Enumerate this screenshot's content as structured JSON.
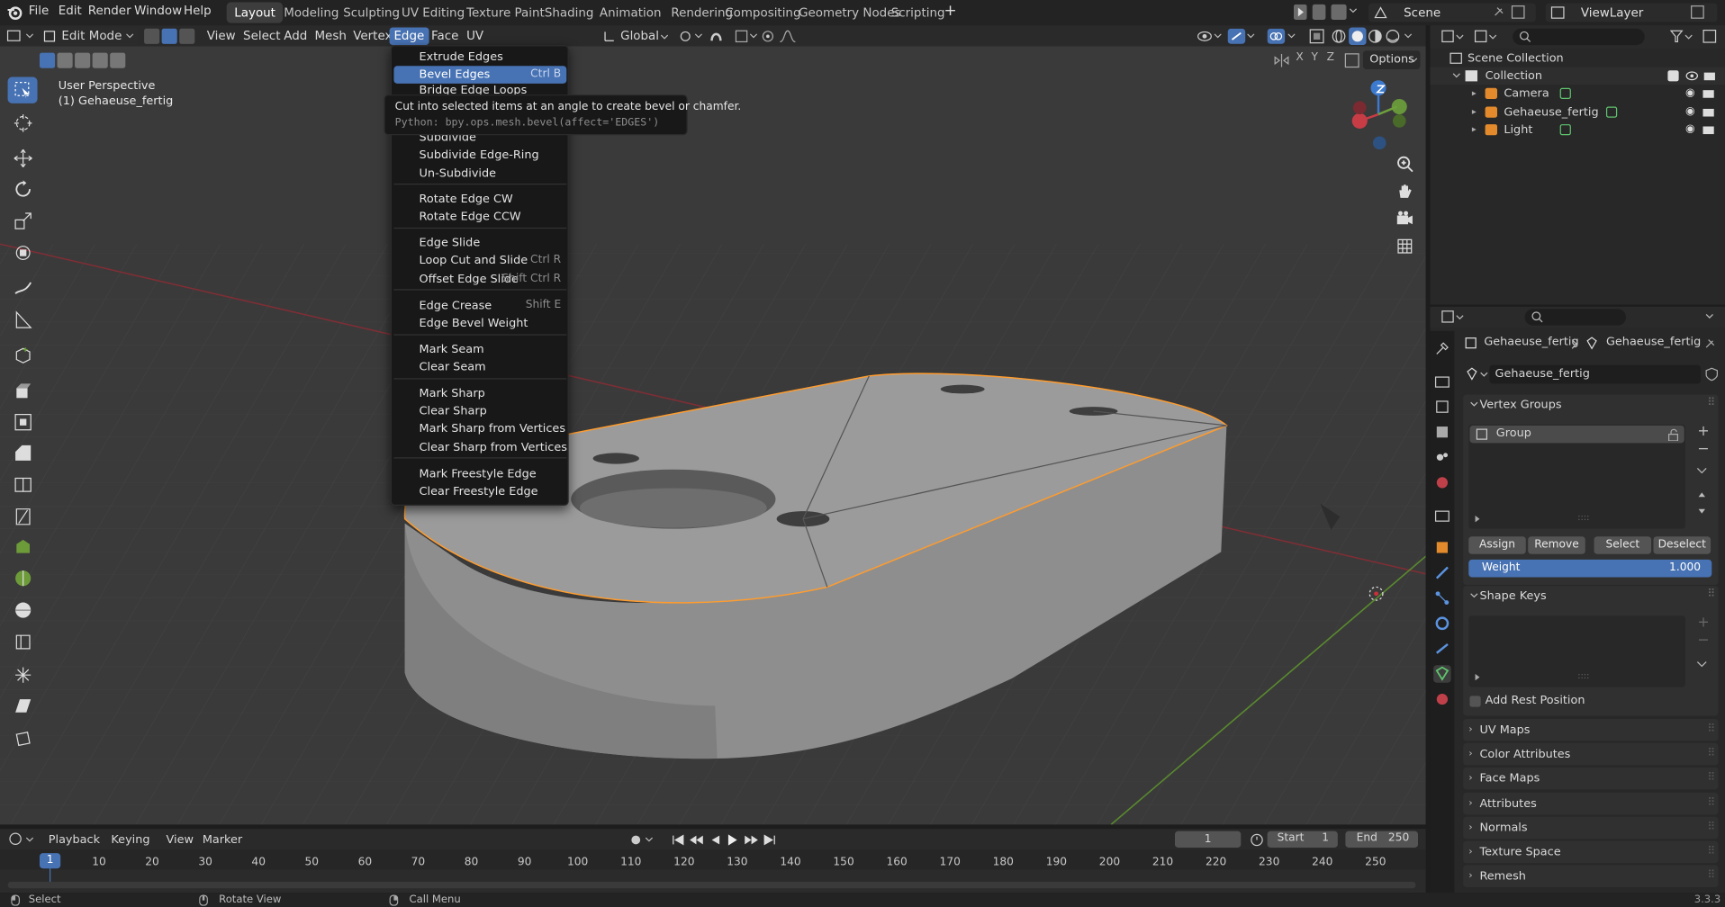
{
  "app_menu": [
    "File",
    "Edit",
    "Render",
    "Window",
    "Help"
  ],
  "workspaces": [
    "Layout",
    "Modeling",
    "Sculpting",
    "UV Editing",
    "Texture Paint",
    "Shading",
    "Animation",
    "Rendering",
    "Compositing",
    "Geometry Nodes",
    "Scripting"
  ],
  "add_workspace": "+",
  "scene_name": "Scene",
  "view_layer": "ViewLayer",
  "viewport_header": {
    "mode": "Edit Mode",
    "menus": [
      "View",
      "Select",
      "Add",
      "Mesh",
      "Vertex",
      "Edge",
      "Face",
      "UV"
    ],
    "transform_orientation": "Global",
    "options": "Options",
    "axes": [
      "X",
      "Y",
      "Z"
    ]
  },
  "viewport": {
    "perspective": "User Perspective",
    "object_label": "(1) Gehaeuse_fertig"
  },
  "edge_menu": {
    "items": [
      {
        "label": "Extrude Edges",
        "shortcut": ""
      },
      {
        "label": "Bevel Edges",
        "shortcut": "Ctrl B"
      },
      {
        "label": "Bridge Edge Loops",
        "shortcut": ""
      },
      {
        "label": "Subdivide",
        "shortcut": ""
      },
      {
        "label": "Subdivide Edge-Ring",
        "shortcut": ""
      },
      {
        "label": "Un-Subdivide",
        "shortcut": ""
      },
      {
        "label": "Rotate Edge CW",
        "shortcut": ""
      },
      {
        "label": "Rotate Edge CCW",
        "shortcut": ""
      },
      {
        "label": "Edge Slide",
        "shortcut": ""
      },
      {
        "label": "Loop Cut and Slide",
        "shortcut": "Ctrl R"
      },
      {
        "label": "Offset Edge Slide",
        "shortcut": "Shift Ctrl R"
      },
      {
        "label": "Edge Crease",
        "shortcut": "Shift E"
      },
      {
        "label": "Edge Bevel Weight",
        "shortcut": ""
      },
      {
        "label": "Mark Seam",
        "shortcut": ""
      },
      {
        "label": "Clear Seam",
        "shortcut": ""
      },
      {
        "label": "Mark Sharp",
        "shortcut": ""
      },
      {
        "label": "Clear Sharp",
        "shortcut": ""
      },
      {
        "label": "Mark Sharp from Vertices",
        "shortcut": ""
      },
      {
        "label": "Clear Sharp from Vertices",
        "shortcut": ""
      },
      {
        "label": "Mark Freestyle Edge",
        "shortcut": ""
      },
      {
        "label": "Clear Freestyle Edge",
        "shortcut": ""
      }
    ]
  },
  "tooltip": {
    "description": "Cut into selected items at an angle to create bevel or chamfer.",
    "python": "Python: bpy.ops.mesh.bevel(affect='EDGES')"
  },
  "outliner": {
    "root": "Scene Collection",
    "collection": "Collection",
    "objects": [
      "Camera",
      "Gehaeuse_fertig",
      "Light"
    ]
  },
  "properties": {
    "breadcrumb": [
      "Gehaeuse_fertig",
      "Gehaeuse_fertig"
    ],
    "mesh_name": "Gehaeuse_fertig",
    "vertex_groups": {
      "title": "Vertex Groups",
      "items": [
        "Group"
      ],
      "buttons": [
        "Assign",
        "Remove",
        "Select",
        "Deselect"
      ],
      "weight_label": "Weight",
      "weight_value": "1.000"
    },
    "shape_keys": {
      "title": "Shape Keys",
      "add_rest_position": "Add Rest Position"
    },
    "collapsed_panels": [
      "UV Maps",
      "Color Attributes",
      "Face Maps",
      "Attributes",
      "Normals",
      "Texture Space",
      "Remesh"
    ]
  },
  "timeline": {
    "menus": [
      "Playback",
      "Keying",
      "View",
      "Marker"
    ],
    "current_frame": "1",
    "start_label": "Start",
    "start": "1",
    "end_label": "End",
    "end": "250",
    "ticks": [
      "1",
      "10",
      "20",
      "30",
      "40",
      "50",
      "60",
      "70",
      "80",
      "90",
      "100",
      "110",
      "120",
      "130",
      "140",
      "150",
      "160",
      "170",
      "180",
      "190",
      "200",
      "210",
      "220",
      "230",
      "240",
      "250"
    ]
  },
  "statusbar": {
    "items": [
      "Select",
      "Rotate View",
      "Call Menu"
    ],
    "version": "3.3.3"
  },
  "colors": {
    "accent": "#4772b3",
    "selection": "#ff9c2e",
    "x_axis": "#c83c46",
    "y_axis": "#6ea13c",
    "z_axis": "#3c7ad0"
  }
}
